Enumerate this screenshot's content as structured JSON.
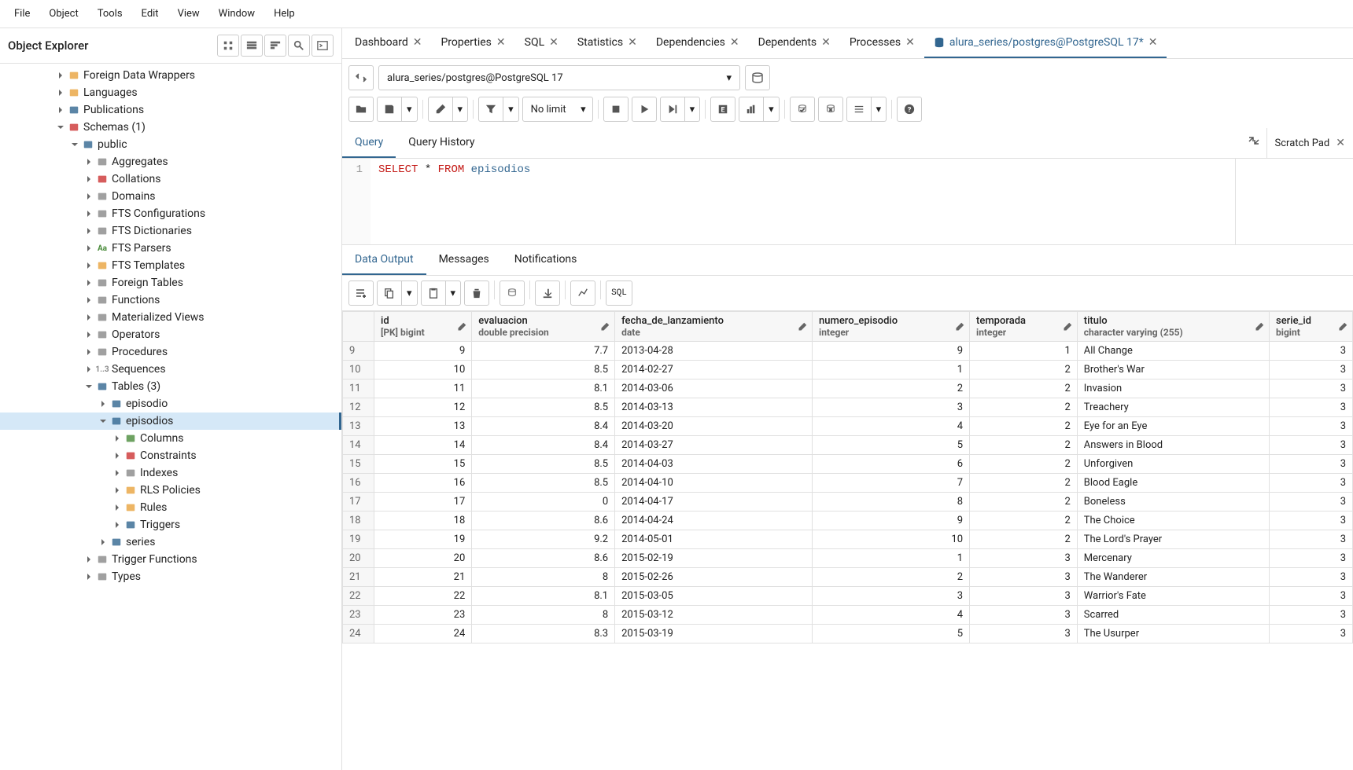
{
  "menubar": [
    "File",
    "Object",
    "Tools",
    "Edit",
    "View",
    "Window",
    "Help"
  ],
  "sidebar": {
    "title": "Object Explorer",
    "tree": [
      {
        "label": "Foreign Data Wrappers",
        "indent": 0,
        "expanded": false,
        "iconColor": "#e8a33d"
      },
      {
        "label": "Languages",
        "indent": 0,
        "expanded": false,
        "iconColor": "#e8a33d"
      },
      {
        "label": "Publications",
        "indent": 0,
        "expanded": false,
        "iconColor": "#326690"
      },
      {
        "label": "Schemas (1)",
        "indent": 0,
        "expanded": true,
        "iconColor": "#cc3333"
      },
      {
        "label": "public",
        "indent": 1,
        "expanded": true,
        "iconColor": "#326690"
      },
      {
        "label": "Aggregates",
        "indent": 2,
        "expanded": false,
        "iconColor": "#888"
      },
      {
        "label": "Collations",
        "indent": 2,
        "expanded": false,
        "iconColor": "#cc3333"
      },
      {
        "label": "Domains",
        "indent": 2,
        "expanded": false,
        "iconColor": "#888"
      },
      {
        "label": "FTS Configurations",
        "indent": 2,
        "expanded": false,
        "iconColor": "#888"
      },
      {
        "label": "FTS Dictionaries",
        "indent": 2,
        "expanded": false,
        "iconColor": "#888"
      },
      {
        "label": "FTS Parsers",
        "indent": 2,
        "expanded": false,
        "iconColor": "#4a8b3b",
        "iconText": "Aa"
      },
      {
        "label": "FTS Templates",
        "indent": 2,
        "expanded": false,
        "iconColor": "#e8a33d"
      },
      {
        "label": "Foreign Tables",
        "indent": 2,
        "expanded": false,
        "iconColor": "#888"
      },
      {
        "label": "Functions",
        "indent": 2,
        "expanded": false,
        "iconColor": "#888"
      },
      {
        "label": "Materialized Views",
        "indent": 2,
        "expanded": false,
        "iconColor": "#888"
      },
      {
        "label": "Operators",
        "indent": 2,
        "expanded": false,
        "iconColor": "#888"
      },
      {
        "label": "Procedures",
        "indent": 2,
        "expanded": false,
        "iconColor": "#888"
      },
      {
        "label": "Sequences",
        "indent": 2,
        "expanded": false,
        "iconColor": "#888",
        "iconText": "1..3"
      },
      {
        "label": "Tables (3)",
        "indent": 2,
        "expanded": true,
        "iconColor": "#326690"
      },
      {
        "label": "episodio",
        "indent": 3,
        "expanded": false,
        "iconColor": "#326690"
      },
      {
        "label": "episodios",
        "indent": 3,
        "expanded": true,
        "iconColor": "#326690",
        "selected": true
      },
      {
        "label": "Columns",
        "indent": 4,
        "expanded": false,
        "iconColor": "#4a8b3b"
      },
      {
        "label": "Constraints",
        "indent": 4,
        "expanded": false,
        "iconColor": "#cc3333"
      },
      {
        "label": "Indexes",
        "indent": 4,
        "expanded": false,
        "iconColor": "#888"
      },
      {
        "label": "RLS Policies",
        "indent": 4,
        "expanded": false,
        "iconColor": "#e8a33d"
      },
      {
        "label": "Rules",
        "indent": 4,
        "expanded": false,
        "iconColor": "#e8a33d"
      },
      {
        "label": "Triggers",
        "indent": 4,
        "expanded": false,
        "iconColor": "#326690"
      },
      {
        "label": "series",
        "indent": 3,
        "expanded": false,
        "iconColor": "#326690"
      },
      {
        "label": "Trigger Functions",
        "indent": 2,
        "expanded": false,
        "iconColor": "#888"
      },
      {
        "label": "Types",
        "indent": 2,
        "expanded": false,
        "iconColor": "#888"
      }
    ]
  },
  "tabs": [
    {
      "label": "Dashboard"
    },
    {
      "label": "Properties"
    },
    {
      "label": "SQL"
    },
    {
      "label": "Statistics"
    },
    {
      "label": "Dependencies"
    },
    {
      "label": "Dependents"
    },
    {
      "label": "Processes"
    },
    {
      "label": "alura_series/postgres@PostgreSQL 17*",
      "active": true,
      "hasIcon": true
    }
  ],
  "connection": "alura_series/postgres@PostgreSQL 17",
  "limit": "No limit",
  "editor": {
    "tabs": [
      "Query",
      "Query History"
    ],
    "scratch": "Scratch Pad",
    "lineNum": "1",
    "code": {
      "select": "SELECT",
      "star": "*",
      "from": "FROM",
      "table": "episodios"
    }
  },
  "output": {
    "tabs": [
      "Data Output",
      "Messages",
      "Notifications"
    ],
    "sqlBtn": "SQL"
  },
  "grid": {
    "columns": [
      {
        "name": "id",
        "type": "[PK] bigint",
        "align": "num"
      },
      {
        "name": "evaluacion",
        "type": "double precision",
        "align": "num"
      },
      {
        "name": "fecha_de_lanzamiento",
        "type": "date",
        "align": "text"
      },
      {
        "name": "numero_episodio",
        "type": "integer",
        "align": "num"
      },
      {
        "name": "temporada",
        "type": "integer",
        "align": "num"
      },
      {
        "name": "titulo",
        "type": "character varying (255)",
        "align": "text"
      },
      {
        "name": "serie_id",
        "type": "bigint",
        "align": "num"
      }
    ],
    "rows": [
      {
        "n": "9",
        "c": [
          "9",
          "7.7",
          "2013-04-28",
          "9",
          "1",
          "All Change",
          "3"
        ]
      },
      {
        "n": "10",
        "c": [
          "10",
          "8.5",
          "2014-02-27",
          "1",
          "2",
          "Brother's War",
          "3"
        ]
      },
      {
        "n": "11",
        "c": [
          "11",
          "8.1",
          "2014-03-06",
          "2",
          "2",
          "Invasion",
          "3"
        ]
      },
      {
        "n": "12",
        "c": [
          "12",
          "8.5",
          "2014-03-13",
          "3",
          "2",
          "Treachery",
          "3"
        ]
      },
      {
        "n": "13",
        "c": [
          "13",
          "8.4",
          "2014-03-20",
          "4",
          "2",
          "Eye for an Eye",
          "3"
        ]
      },
      {
        "n": "14",
        "c": [
          "14",
          "8.4",
          "2014-03-27",
          "5",
          "2",
          "Answers in Blood",
          "3"
        ]
      },
      {
        "n": "15",
        "c": [
          "15",
          "8.5",
          "2014-04-03",
          "6",
          "2",
          "Unforgiven",
          "3"
        ]
      },
      {
        "n": "16",
        "c": [
          "16",
          "8.5",
          "2014-04-10",
          "7",
          "2",
          "Blood Eagle",
          "3"
        ]
      },
      {
        "n": "17",
        "c": [
          "17",
          "0",
          "2014-04-17",
          "8",
          "2",
          "Boneless",
          "3"
        ]
      },
      {
        "n": "18",
        "c": [
          "18",
          "8.6",
          "2014-04-24",
          "9",
          "2",
          "The Choice",
          "3"
        ]
      },
      {
        "n": "19",
        "c": [
          "19",
          "9.2",
          "2014-05-01",
          "10",
          "2",
          "The Lord's Prayer",
          "3"
        ]
      },
      {
        "n": "20",
        "c": [
          "20",
          "8.6",
          "2015-02-19",
          "1",
          "3",
          "Mercenary",
          "3"
        ]
      },
      {
        "n": "21",
        "c": [
          "21",
          "8",
          "2015-02-26",
          "2",
          "3",
          "The Wanderer",
          "3"
        ]
      },
      {
        "n": "22",
        "c": [
          "22",
          "8.1",
          "2015-03-05",
          "3",
          "3",
          "Warrior's Fate",
          "3"
        ]
      },
      {
        "n": "23",
        "c": [
          "23",
          "8",
          "2015-03-12",
          "4",
          "3",
          "Scarred",
          "3"
        ]
      },
      {
        "n": "24",
        "c": [
          "24",
          "8.3",
          "2015-03-19",
          "5",
          "3",
          "The Usurper",
          "3"
        ]
      }
    ]
  }
}
